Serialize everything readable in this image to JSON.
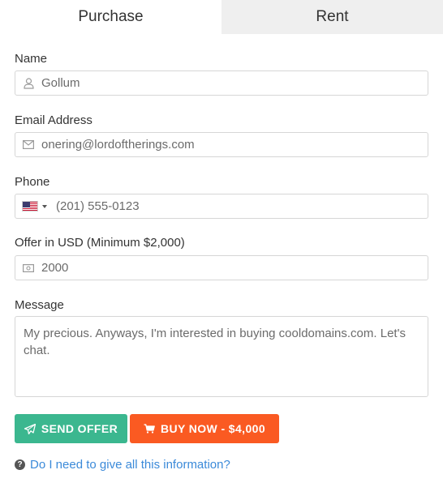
{
  "tabs": [
    {
      "label": "Purchase",
      "active": true
    },
    {
      "label": "Rent",
      "active": false
    }
  ],
  "form": {
    "name": {
      "label": "Name",
      "value": "Gollum",
      "icon": "user-icon"
    },
    "email": {
      "label": "Email Address",
      "value": "onering@lordoftherings.com",
      "icon": "envelope-icon"
    },
    "phone": {
      "label": "Phone",
      "value": "(201) 555-0123",
      "country_flag": "us-flag-icon"
    },
    "offer": {
      "label": "Offer in USD (Minimum $2,000)",
      "value": "2000",
      "icon": "money-icon"
    },
    "message": {
      "label": "Message",
      "value": "My precious. Anyways, I'm interested in buying cooldomains.com. Let's chat."
    }
  },
  "buttons": {
    "send_offer": {
      "label": "SEND OFFER",
      "icon": "paper-plane-icon",
      "color": "#3bb78f"
    },
    "buy_now": {
      "label": "BUY NOW - $4,000",
      "icon": "cart-icon",
      "color": "#fa5a22"
    }
  },
  "help": {
    "label": "Do I need to give all this information?",
    "icon": "question-circle-icon"
  }
}
